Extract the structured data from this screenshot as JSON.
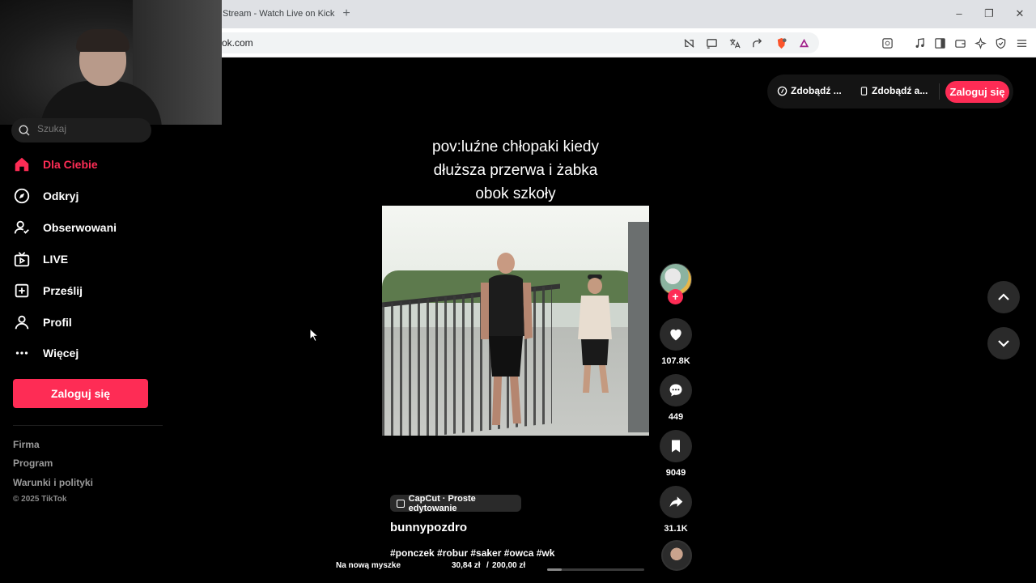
{
  "browser": {
    "tab_title": "Stream - Watch Live on Kick",
    "new_tab": "+",
    "url": "ok.com",
    "window_controls": {
      "minimize": "–",
      "restore": "❐",
      "close": "✕"
    }
  },
  "sidebar": {
    "search_placeholder": "Szukaj",
    "items": [
      {
        "label": "Dla Ciebie",
        "icon": "home-icon",
        "active": true
      },
      {
        "label": "Odkryj",
        "icon": "compass-icon"
      },
      {
        "label": "Obserwowani",
        "icon": "following-icon"
      },
      {
        "label": "LIVE",
        "icon": "live-tv-icon"
      },
      {
        "label": "Prześlij",
        "icon": "upload-icon"
      },
      {
        "label": "Profil",
        "icon": "profile-icon"
      },
      {
        "label": "Więcej",
        "icon": "more-icon"
      }
    ],
    "login_label": "Zaloguj się",
    "footer_links": [
      "Firma",
      "Program",
      "Warunki i polityki"
    ],
    "copyright": "© 2025 TikTok"
  },
  "top_bar": {
    "get_coins_label": "Zdobądź ...",
    "get_app_label": "Zdobądź a...",
    "login_label": "Zaloguj się"
  },
  "video": {
    "caption_lines": [
      "pov:luźne chłopaki kiedy",
      "dłuższa przerwa i żabka",
      "obok szkoły"
    ],
    "capcut_label": "CapCut · Proste edytowanie",
    "author": "bunnypozdro",
    "hashtags": "#ponczek #robur #saker #owca #wk",
    "overlay_left": "Na nową myszke",
    "overlay_amount": "30,84 zł",
    "overlay_sep": "/",
    "overlay_goal": "200,00 zł",
    "goal_progress": 0.15
  },
  "actions": {
    "likes": "107.8K",
    "comments": "449",
    "saves": "9049",
    "shares": "31.1K"
  },
  "colors": {
    "accent": "#fe2c55",
    "background": "#000000",
    "rail_button": "#2a2a2a"
  }
}
